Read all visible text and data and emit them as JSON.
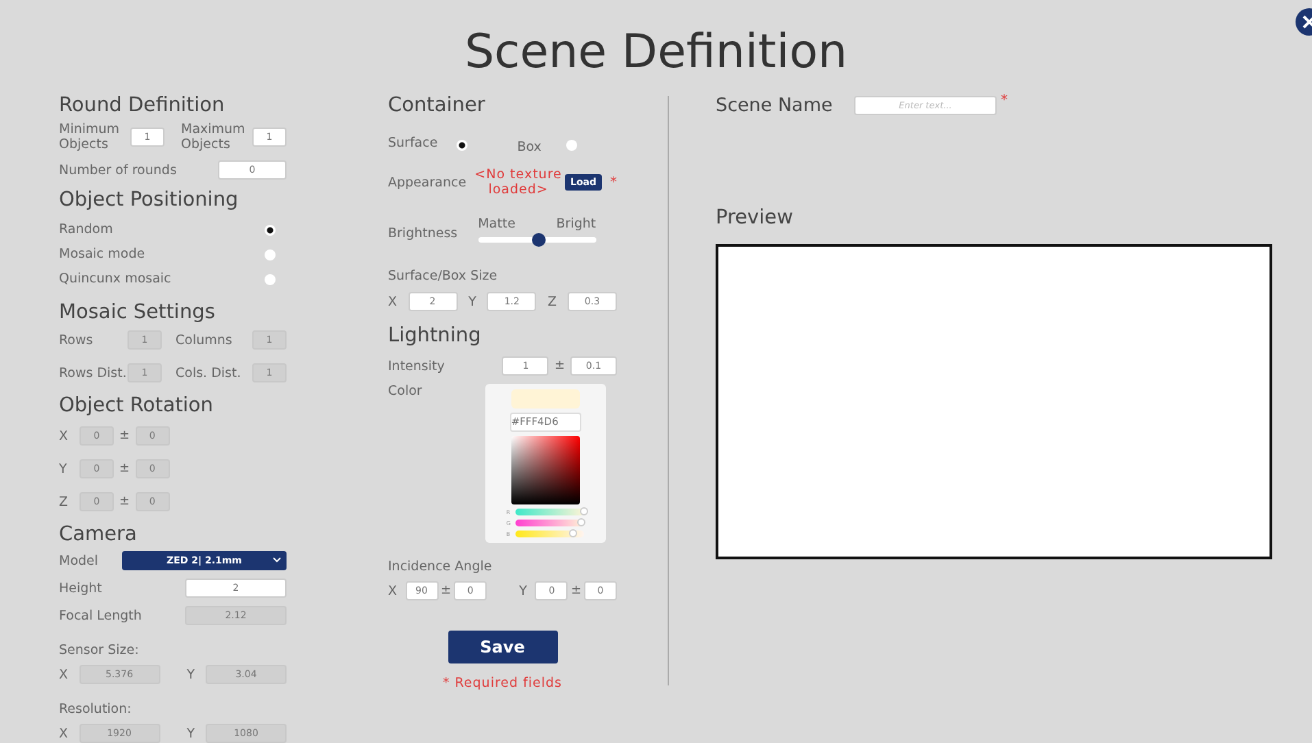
{
  "title": "Scene Definition",
  "round_definition": {
    "heading": "Round Definition",
    "minimum": {
      "label": "Minimum Objects",
      "value": "1",
      "disabled": false
    },
    "maximum": {
      "label": "Maximum Objects",
      "value": "1",
      "disabled": false
    },
    "rounds": {
      "label": "Number of rounds",
      "value": "0",
      "disabled": false
    }
  },
  "object_positioning": {
    "heading": "Object Positioning",
    "options": [
      {
        "label": "Random",
        "selected": true
      },
      {
        "label": "Mosaic mode",
        "selected": false
      },
      {
        "label": "Quincunx mosaic",
        "selected": false
      }
    ]
  },
  "mosaic_settings": {
    "heading": "Mosaic Settings",
    "fields": [
      {
        "label": "Rows",
        "value": "1",
        "disabled": true
      },
      {
        "label": "Columns",
        "value": "1",
        "disabled": true
      },
      {
        "label": "Rows Dist.",
        "value": "1",
        "disabled": true
      },
      {
        "label": "Cols. Dist.",
        "value": "1",
        "disabled": true
      }
    ]
  },
  "object_rotation": {
    "heading": "Object Rotation",
    "axes": [
      {
        "axis": "X",
        "value": "0",
        "sign": "±",
        "tolerance": "0",
        "disabled": true
      },
      {
        "axis": "Y",
        "value": "0",
        "sign": "±",
        "tolerance": "0",
        "disabled": true
      },
      {
        "axis": "Z",
        "value": "0",
        "sign": "±",
        "tolerance": "0",
        "disabled": true
      }
    ]
  },
  "camera": {
    "heading": "Camera",
    "model": {
      "label": "Model",
      "value": "ZED 2| 2.1mm"
    },
    "height": {
      "label": "Height",
      "value": "2",
      "disabled": false
    },
    "focal_length": {
      "label": "Focal Length",
      "value": "2.12",
      "disabled": true
    },
    "sensor_size": {
      "label": "Sensor Size:",
      "axes": [
        {
          "axis": "X",
          "value": "5.376",
          "disabled": true
        },
        {
          "axis": "Y",
          "value": "3.04",
          "disabled": true
        }
      ]
    },
    "resolution": {
      "label": "Resolution:",
      "axes": [
        {
          "axis": "X",
          "value": "1920",
          "disabled": true
        },
        {
          "axis": "Y",
          "value": "1080",
          "disabled": true
        }
      ]
    }
  },
  "container": {
    "heading": "Container",
    "types": [
      {
        "label": "Surface",
        "selected": true
      },
      {
        "label": "Box",
        "selected": false
      }
    ],
    "appearance": {
      "label": "Appearance",
      "status": "<No texture loaded>",
      "button": "Load",
      "required_mark": "*"
    },
    "brightness": {
      "label": "Brightness",
      "min_label": "Matte",
      "max_label": "Bright",
      "level": 0.52
    },
    "size": {
      "label": "Surface/Box Size",
      "axes": [
        {
          "axis": "X",
          "value": "2",
          "disabled": false
        },
        {
          "axis": "Y",
          "value": "1.2",
          "disabled": false
        },
        {
          "axis": "Z",
          "value": "0.3",
          "disabled": false
        }
      ]
    }
  },
  "lighting": {
    "heading": "Lightning",
    "intensity": {
      "label": "Intensity",
      "value": "1",
      "sign": "±",
      "tolerance": "0.1"
    },
    "color": {
      "label": "Color",
      "hex": "#FFF4D6",
      "channels": [
        {
          "name": "R",
          "level": 1.0
        },
        {
          "name": "G",
          "level": 0.96
        },
        {
          "name": "B",
          "level": 0.84
        }
      ]
    },
    "incidence": {
      "label": "Incidence Angle",
      "axes": [
        {
          "axis": "X",
          "value": "90",
          "sign": "±",
          "tolerance": "0"
        },
        {
          "axis": "Y",
          "value": "0",
          "sign": "±",
          "tolerance": "0"
        }
      ]
    }
  },
  "save_button": "Save",
  "required_note": "* Required fields",
  "scene_name": {
    "label": "Scene Name",
    "placeholder": "Enter text...",
    "required_mark": "*"
  },
  "preview": {
    "heading": "Preview"
  }
}
